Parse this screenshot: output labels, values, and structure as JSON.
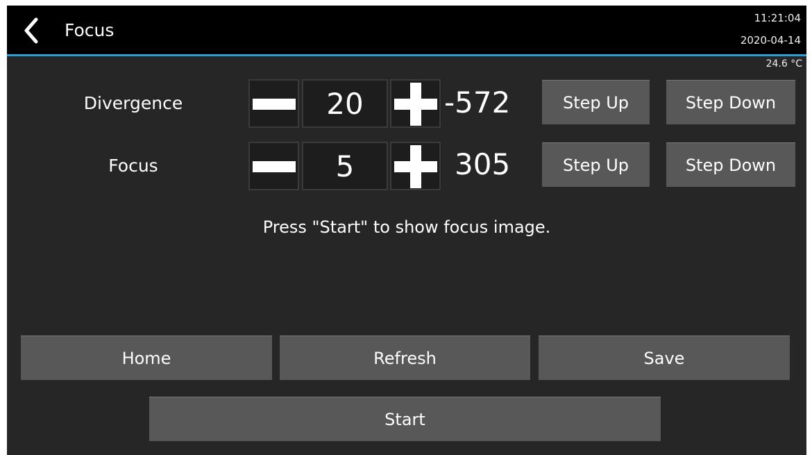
{
  "header": {
    "back_icon": "chevron-left-icon",
    "title": "Focus",
    "time": "11:21:04",
    "date": "2020-04-14",
    "accent_color": "#2a9fd6"
  },
  "status": {
    "temperature": "24.6 °C"
  },
  "controls": [
    {
      "label": "Divergence",
      "minus_icon": "minus-icon",
      "step": "20",
      "plus_icon": "plus-icon",
      "position": "-572",
      "step_up_label": "Step Up",
      "step_down_label": "Step Down"
    },
    {
      "label": "Focus",
      "minus_icon": "minus-icon",
      "step": "5",
      "plus_icon": "plus-icon",
      "position": "305",
      "step_up_label": "Step Up",
      "step_down_label": "Step Down"
    }
  ],
  "message": "Press \"Start\" to show focus image.",
  "actions": {
    "home_label": "Home",
    "refresh_label": "Refresh",
    "save_label": "Save",
    "start_label": "Start"
  }
}
